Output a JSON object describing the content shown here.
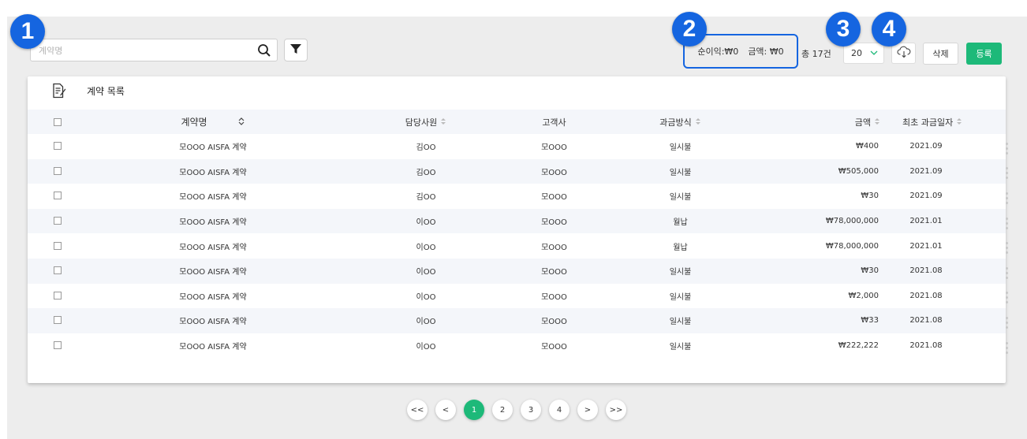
{
  "search": {
    "placeholder": "계약명",
    "value": ""
  },
  "markers": [
    "1",
    "2",
    "3",
    "4"
  ],
  "summary": {
    "net_profit": "순이익:₩0",
    "amount": "금액: ₩0"
  },
  "total": "총 17건",
  "page_size": "20",
  "buttons": {
    "delete": "삭제",
    "register": "등록"
  },
  "card": {
    "title": "계약 목록"
  },
  "table": {
    "columns": [
      "계약명",
      "담당사원",
      "고객사",
      "과금방식",
      "금액",
      "최초 과금일자"
    ],
    "rows": [
      [
        "모OOO AISFA 계약",
        "김OO",
        "모OOO",
        "일시불",
        "₩400",
        "2021.09"
      ],
      [
        "모OOO AISFA 계약",
        "김OO",
        "모OOO",
        "일시불",
        "₩505,000",
        "2021.09"
      ],
      [
        "모OOO AISFA 계약",
        "김OO",
        "모OOO",
        "일시불",
        "₩30",
        "2021.09"
      ],
      [
        "모OOO AISFA 계약",
        "이OO",
        "모OOO",
        "월납",
        "₩78,000,000",
        "2021.01"
      ],
      [
        "모OOO AISFA 계약",
        "이OO",
        "모OOO",
        "월납",
        "₩78,000,000",
        "2021.01"
      ],
      [
        "모OOO AISFA 계약",
        "이OO",
        "모OOO",
        "일시불",
        "₩30",
        "2021.08"
      ],
      [
        "모OOO AISFA 계약",
        "이OO",
        "모OOO",
        "일시불",
        "₩2,000",
        "2021.08"
      ],
      [
        "모OOO AISFA 계약",
        "이OO",
        "모OOO",
        "일시불",
        "₩33",
        "2021.08"
      ],
      [
        "모OOO AISFA 계약",
        "이OO",
        "모OOO",
        "일시불",
        "₩222,222",
        "2021.08"
      ]
    ]
  },
  "pagination": {
    "first": "<<",
    "prev": "<",
    "pages": [
      "1",
      "2",
      "3",
      "4"
    ],
    "current": "1",
    "next": ">",
    "last": ">>"
  },
  "colors": {
    "accent_blue": "#1565e0",
    "green": "#1db979",
    "background": "#ededed"
  }
}
